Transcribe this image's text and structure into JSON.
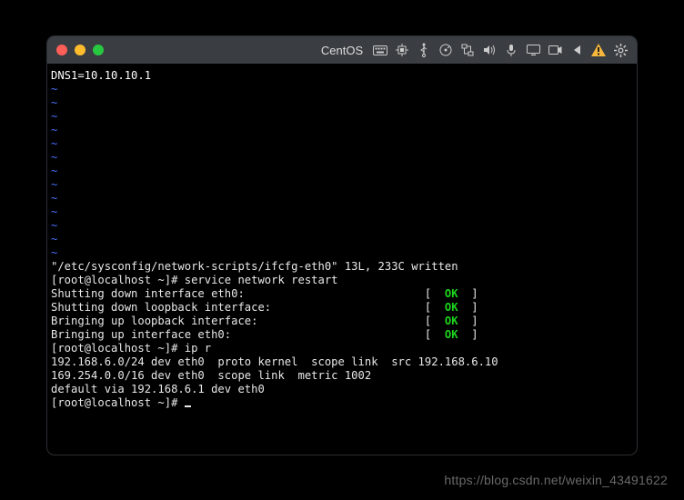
{
  "window": {
    "title": "CentOS"
  },
  "toolbar": {
    "icons": [
      "keyboard-icon",
      "cpu-icon",
      "usb-icon",
      "disc-icon",
      "network-icon",
      "sound-icon",
      "mic-icon",
      "display-icon",
      "camera-icon",
      "back-icon",
      "warning-icon",
      "settings-icon"
    ]
  },
  "terminal": {
    "dns_line": "DNS1=10.10.10.1",
    "tilde_count": 13,
    "written_line": "\"/etc/sysconfig/network-scripts/ifcfg-eth0\" 13L, 233C written",
    "prompt1": "[root@localhost ~]# service network restart",
    "status_lines": [
      {
        "label": "Shutting down interface eth0:  ",
        "ok": "OK"
      },
      {
        "label": "Shutting down loopback interface:  ",
        "ok": "OK"
      },
      {
        "label": "Bringing up loopback interface:  ",
        "ok": "OK"
      },
      {
        "label": "Bringing up interface eth0:  ",
        "ok": "OK"
      }
    ],
    "prompt2": "[root@localhost ~]# ip r",
    "route1": "192.168.6.0/24 dev eth0  proto kernel  scope link  src 192.168.6.10",
    "route2": "169.254.0.0/16 dev eth0  scope link  metric 1002",
    "route3": "default via 192.168.6.1 dev eth0",
    "prompt3": "[root@localhost ~]# "
  },
  "watermark": "https://blog.csdn.net/weixin_43491622"
}
